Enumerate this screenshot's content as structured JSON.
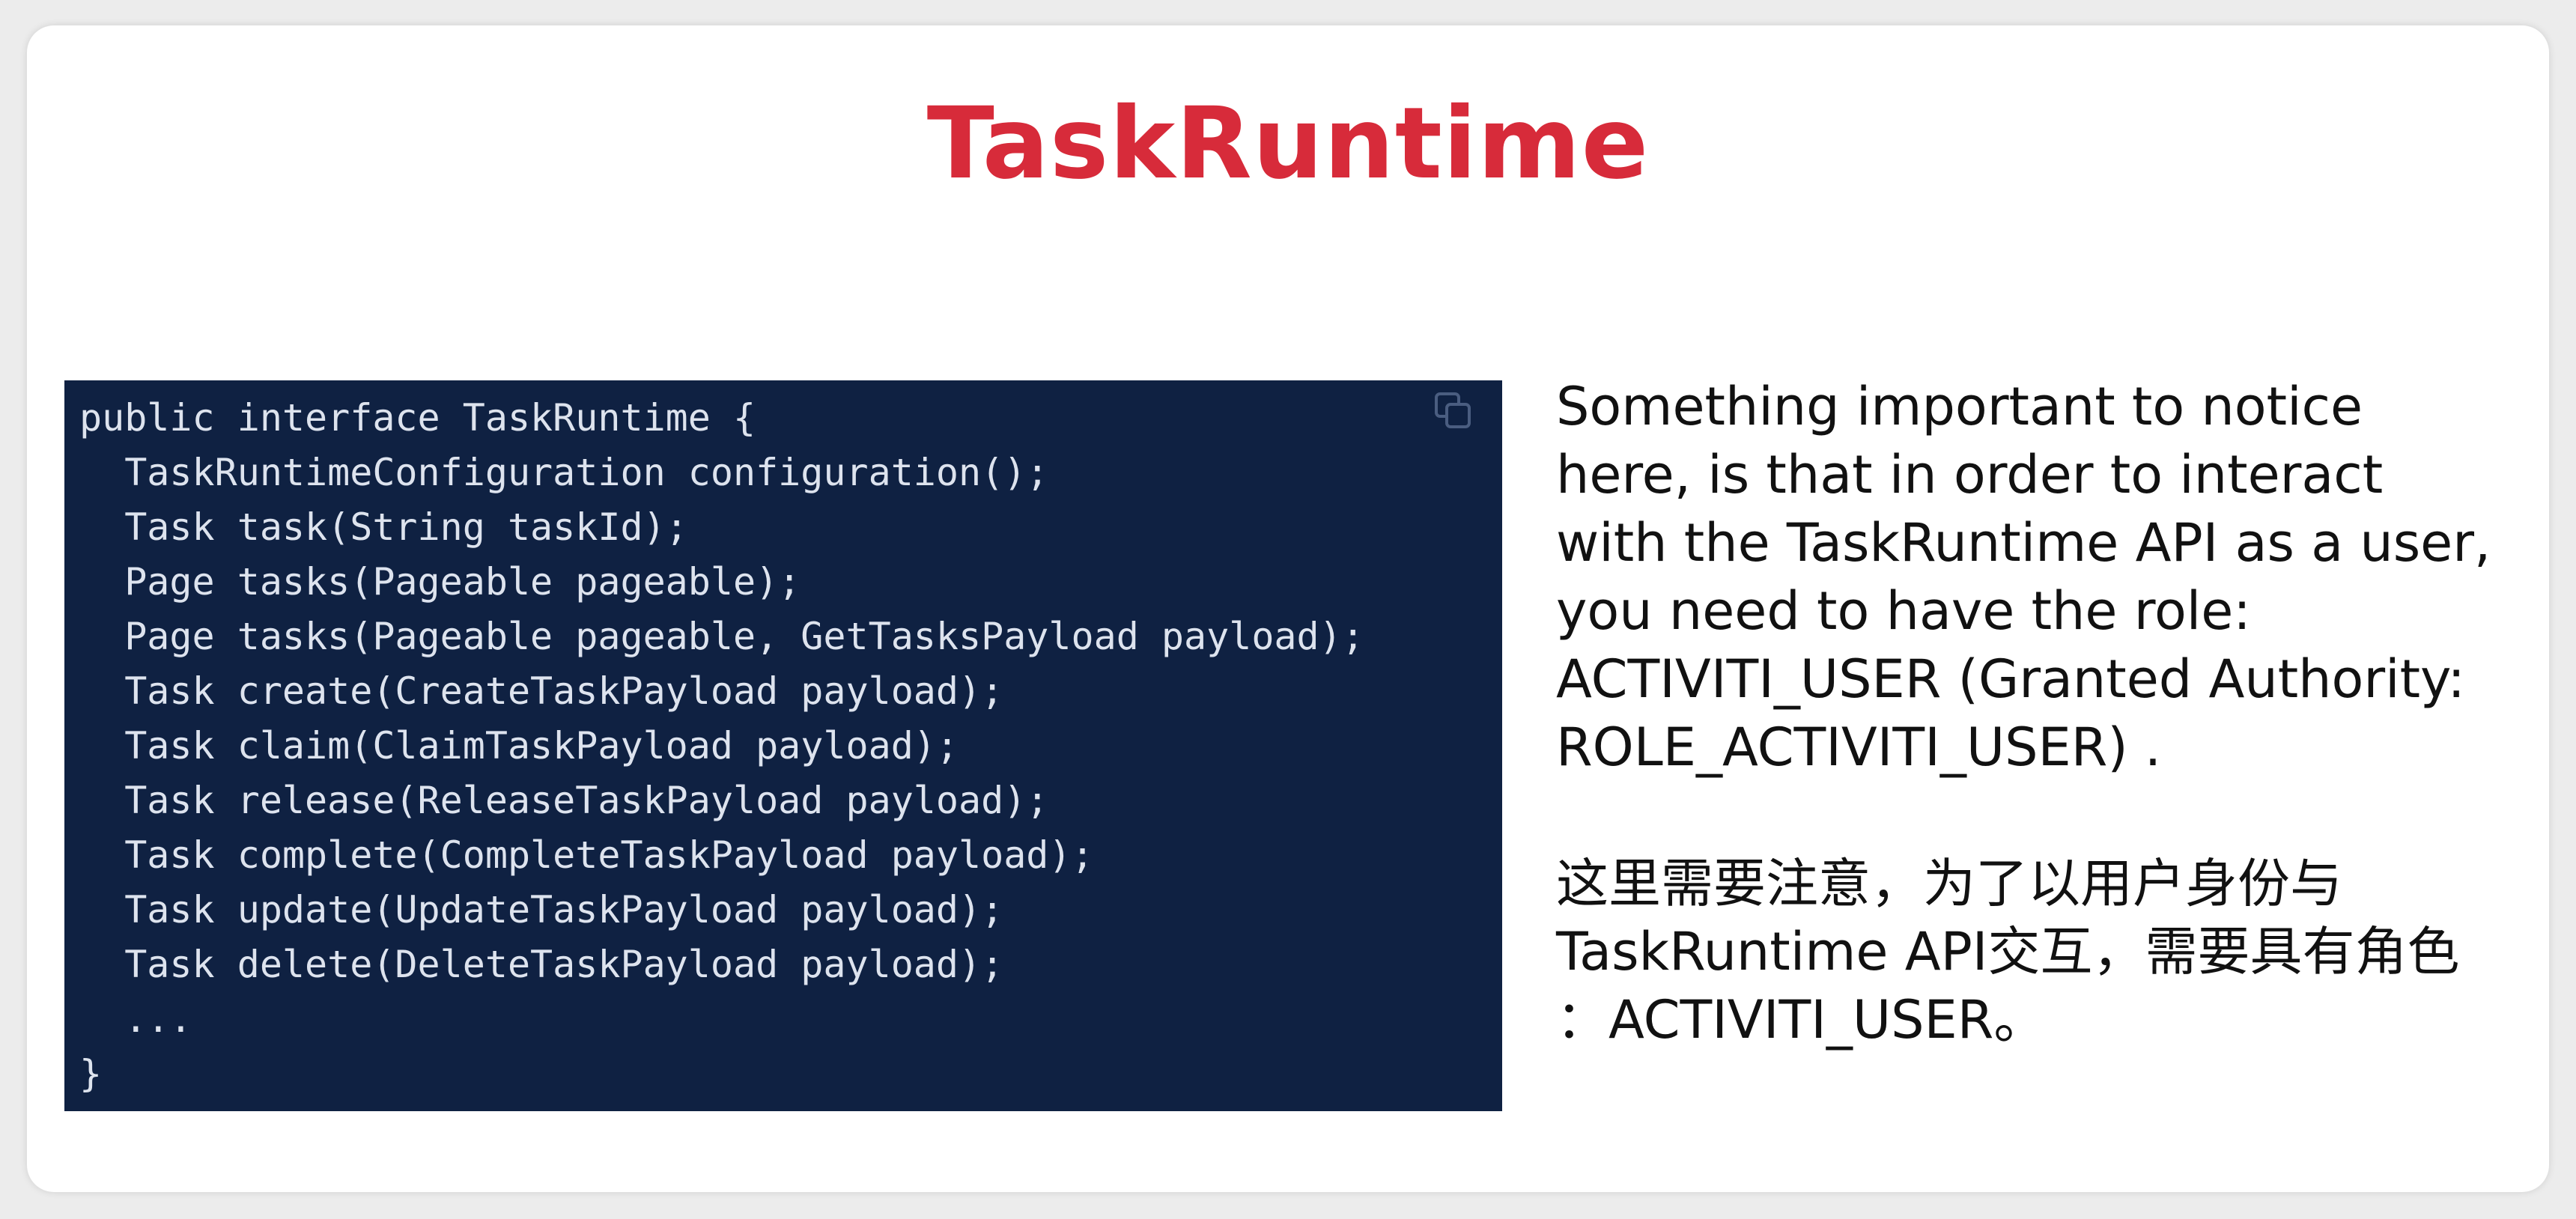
{
  "slide": {
    "title": "TaskRuntime",
    "code": {
      "lines": [
        "public interface TaskRuntime {",
        "  TaskRuntimeConfiguration configuration();",
        "  Task task(String taskId);",
        "  Page tasks(Pageable pageable);",
        "  Page tasks(Pageable pageable, GetTasksPayload payload);",
        "  Task create(CreateTaskPayload payload);",
        "  Task claim(ClaimTaskPayload payload);",
        "  Task release(ReleaseTaskPayload payload);",
        "  Task complete(CompleteTaskPayload payload);",
        "  Task update(UpdateTaskPayload payload);",
        "  Task delete(DeleteTaskPayload payload);",
        "  ...",
        "}"
      ],
      "copy_icon": "copy-icon"
    },
    "explanation_en": [
      "Something important to notice",
      "here, is that in order to interact",
      "with the TaskRuntime API as a user,",
      "you need to have the role:",
      "ACTIVITI_USER (Granted Authority:",
      "ROLE_ACTIVITI_USER) ."
    ],
    "explanation_zh": [
      "这里需要注意，为了以用户身份与",
      "TaskRuntime API交互，需要具有角色",
      "：ACTIVITI_USER。"
    ]
  },
  "colors": {
    "title": "#d72b3a",
    "code_background": "#0f2142",
    "code_text": "#dde3ee",
    "body_text": "#111111",
    "card_background": "#ffffff"
  }
}
